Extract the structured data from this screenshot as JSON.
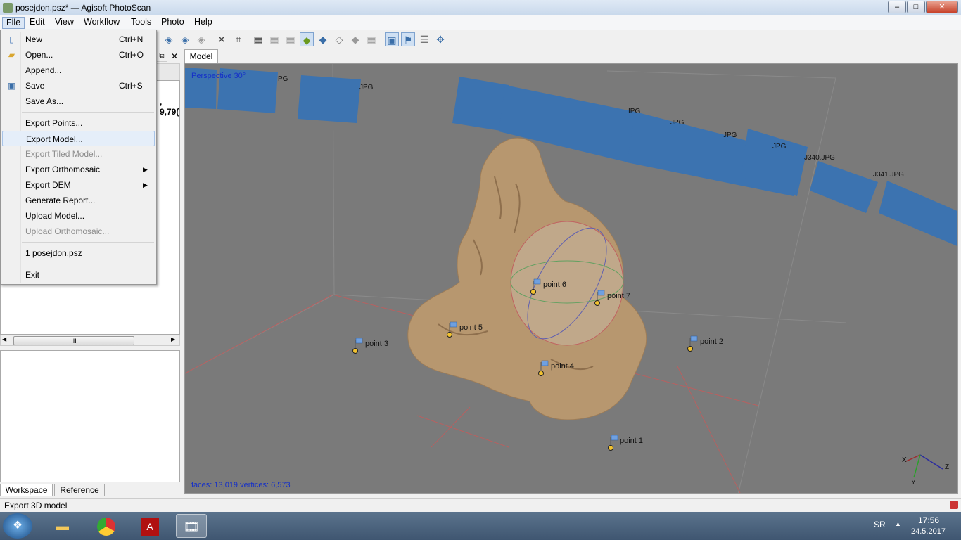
{
  "window": {
    "title": "posejdon.psz* — Agisoft PhotoScan",
    "min": "–",
    "max": "□",
    "close": "✕"
  },
  "menubar": {
    "items": [
      "File",
      "Edit",
      "View",
      "Workflow",
      "Tools",
      "Photo",
      "Help"
    ]
  },
  "file_menu": {
    "new": "New",
    "new_sc": "Ctrl+N",
    "open": "Open...",
    "open_sc": "Ctrl+O",
    "append": "Append...",
    "save": "Save",
    "save_sc": "Ctrl+S",
    "save_as": "Save As...",
    "export_points": "Export Points...",
    "export_model": "Export Model...",
    "export_tiled": "Export Tiled Model...",
    "export_ortho": "Export Orthomosaic",
    "export_dem": "Export DEM",
    "gen_report": "Generate Report...",
    "upload_model": "Upload Model...",
    "upload_ortho": "Upload Orthomosaic...",
    "recent": "1 posejdon.psz",
    "exit": "Exit"
  },
  "left_panel": {
    "partial_value": ", 9,79(",
    "tabs": [
      "Workspace",
      "Reference"
    ],
    "scroll_thumb": "III"
  },
  "model_tab": "Model",
  "viewport": {
    "projection": "Perspective 30°",
    "stats": "faces: 13,019 vertices: 6,573",
    "camera_labels": [
      "PG",
      "JPG",
      "IPG",
      "JPG",
      "JPG",
      "JPG",
      "J340.JPG",
      "J341.JPG"
    ],
    "markers": [
      "point 1",
      "point 2",
      "point 3",
      "point 4",
      "point 5",
      "point 6",
      "point 7"
    ],
    "axes": [
      "X",
      "Z",
      "Y"
    ],
    "colors": {
      "background": "#7a7a7a",
      "model": "#b7976f",
      "camera": "#3c73b0",
      "marker": "#f2c230"
    }
  },
  "status": {
    "text": "Export 3D model"
  },
  "taskbar": {
    "lang": "SR",
    "time": "17:56",
    "date": "24.5.2017"
  }
}
